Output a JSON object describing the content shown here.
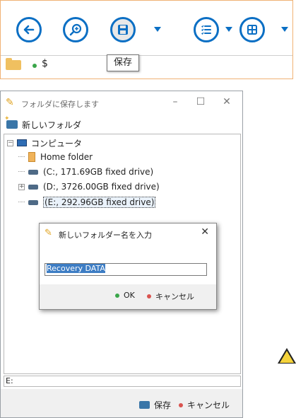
{
  "toolbar": {
    "buttons": [
      {
        "icon": "back-arrow-icon"
      },
      {
        "icon": "search-icon"
      },
      {
        "icon": "save-icon"
      },
      {
        "icon": "list-icon"
      },
      {
        "icon": "grid-icon"
      }
    ],
    "address": {
      "path": "$"
    },
    "tooltip": "保存"
  },
  "window": {
    "title": "フォルダに保存します",
    "new_folder_label": "新しいフォルダ",
    "tree": [
      {
        "label": "コンピュータ",
        "icon": "computer-icon"
      },
      {
        "label": "Home folder",
        "icon": "home-folder-icon"
      },
      {
        "label": "(C:, 171.69GB fixed drive)",
        "icon": "drive-icon"
      },
      {
        "label": "(D:, 3726.00GB fixed drive)",
        "icon": "drive-icon"
      },
      {
        "label": "(E:, 292.96GB fixed drive)",
        "icon": "drive-icon"
      }
    ],
    "path_value": "E:",
    "save_label": "保存",
    "cancel_label": "キャンセル"
  },
  "dialog": {
    "title": "新しいフォルダー名を入力",
    "input_value": "Recovery DATA",
    "ok_label": "OK",
    "cancel_label": "キャンセル"
  },
  "colors": {
    "accent": "#0b6fc4",
    "ok_dot": "#3aa64a",
    "cancel_dot": "#d9534f"
  }
}
